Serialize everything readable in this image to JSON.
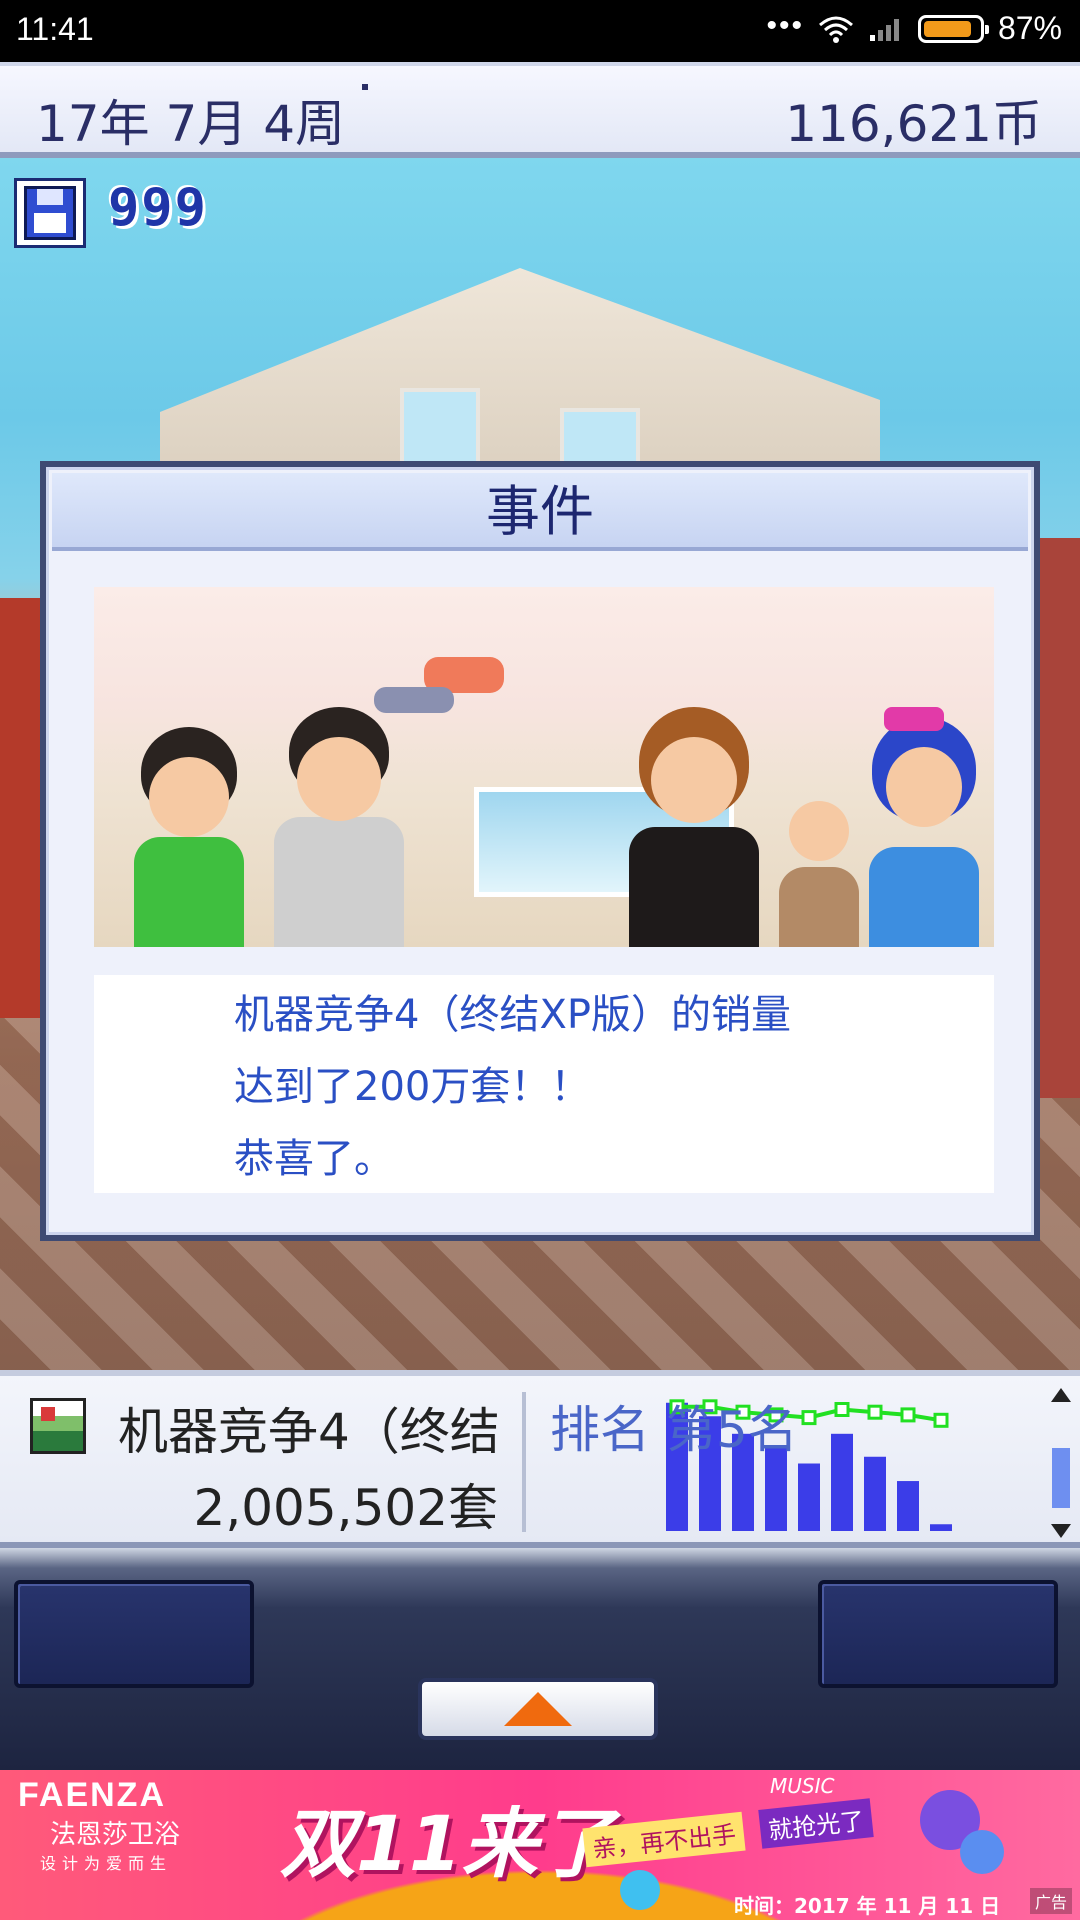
{
  "status_bar": {
    "time": "11:41",
    "battery_percent_text": "87%",
    "battery_level": 0.87
  },
  "top_bar": {
    "date": "17年 7月 4周",
    "money": "116,621币"
  },
  "save": {
    "count": "999",
    "icon": "floppy-disk-icon"
  },
  "event_dialog": {
    "title": "事件",
    "lines": [
      "机器竞争4（终结XP版）的销量",
      "达到了200万套！！",
      "恭喜了。"
    ]
  },
  "info_panel": {
    "game_name": "机器竞争4（终结",
    "sales": "2,005,502套",
    "rank": "排名 第5名"
  },
  "chart_data": {
    "type": "bar",
    "title": "",
    "categories": [
      "1",
      "2",
      "3",
      "4",
      "5",
      "6",
      "7",
      "8",
      "9"
    ],
    "series": [
      {
        "values": [
          0.95,
          0.85,
          0.72,
          0.63,
          0.5,
          0.72,
          0.55,
          0.37,
          0.05
        ],
        "color": "#3b3de8"
      },
      {
        "values": [
          0.92,
          0.92,
          0.88,
          0.86,
          0.84,
          0.9,
          0.88,
          0.86,
          0.82
        ],
        "color": "#22e022"
      }
    ]
  },
  "controls": {
    "up_icon": "up-arrow-icon"
  },
  "ad": {
    "brand": "FAENZA",
    "brand_cn": "法恩莎卫浴",
    "brand_sub": "设计为爱而生",
    "headline": "双11来了",
    "tag1": "亲，再不出手",
    "tag2": "就抢光了",
    "music": "MUSIC",
    "date": "时间：2017 年 11 月 11 日",
    "label": "广告"
  },
  "colors": {
    "accent_text": "#2a4fc4",
    "dialog_border": "#3e4a73",
    "bar": "#3b3de8",
    "line": "#22e022",
    "up_arrow": "#f06a0e"
  }
}
